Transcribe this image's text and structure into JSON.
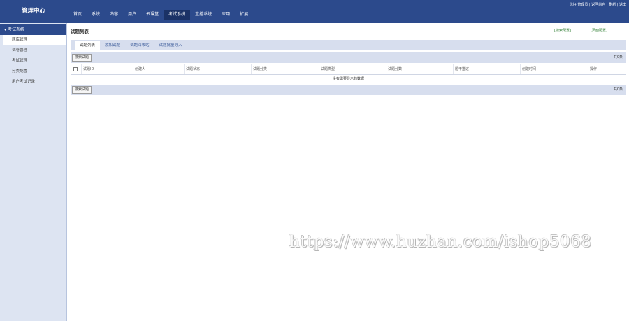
{
  "header": {
    "logo": "管理中心",
    "nav": [
      {
        "label": "首页"
      },
      {
        "label": "系统"
      },
      {
        "label": "内容"
      },
      {
        "label": "用户"
      },
      {
        "label": "云课堂"
      },
      {
        "label": "考试系统",
        "active": true
      },
      {
        "label": "直播系统"
      },
      {
        "label": "应用"
      },
      {
        "label": "扩展"
      }
    ],
    "user": {
      "greeting": "您好 管理员",
      "sep": " | ",
      "back_home": "返回前台",
      "refresh": "刷新",
      "logout": "退出"
    }
  },
  "sidebar": {
    "section": "考试系统",
    "items": [
      {
        "label": "题库管理",
        "active": true
      },
      {
        "label": "试卷管理"
      },
      {
        "label": "考试管理"
      },
      {
        "label": "分类配置"
      },
      {
        "label": "用户考试记录"
      }
    ]
  },
  "main": {
    "title": "试题列表",
    "link1": "[搜索配置]",
    "link2": "[页面配置]",
    "tabs": [
      {
        "label": "试题列表",
        "active": true
      },
      {
        "label": "添加试题"
      },
      {
        "label": "试题回收站"
      },
      {
        "label": "试题批量导入"
      }
    ],
    "search_button": "搜索试题",
    "count": "共0条",
    "columns": [
      "试题ID",
      "创建人",
      "试题状态",
      "试题分类",
      "试题类型",
      "试题分数",
      "题干描述",
      "创建时间",
      "操作"
    ],
    "empty": "没有需要显示的数据"
  },
  "watermark": "https://www.huzhan.com/ishop5068"
}
